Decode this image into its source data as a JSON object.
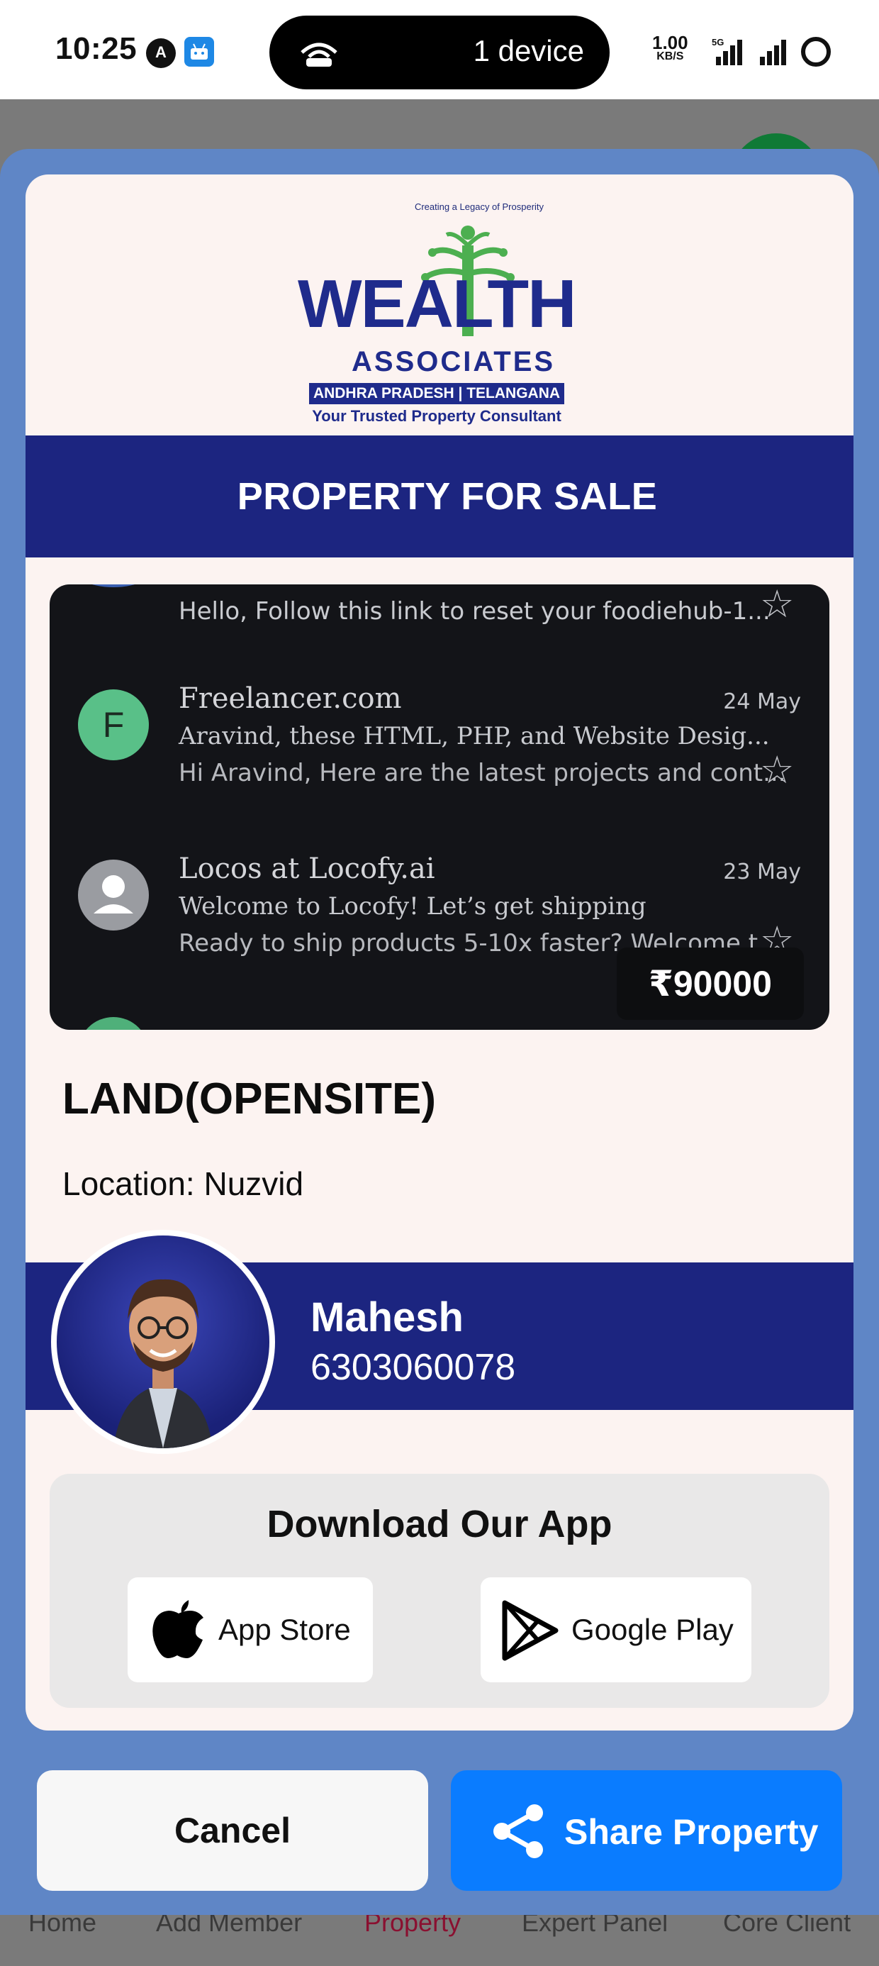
{
  "status_bar": {
    "time": "10:25",
    "hotspot_text": "1 device",
    "net_speed": "1.00",
    "net_unit": "KB/S",
    "icons": [
      "app-a-icon",
      "android-icon",
      "hotspot-icon",
      "5g-signal-icon",
      "signal-icon",
      "ring-icon"
    ]
  },
  "background_nav": {
    "items": [
      "Home",
      "Add Member",
      "Property",
      "Expert Panel",
      "Core Client"
    ],
    "active": "Property",
    "active_color": "#8a1030"
  },
  "logo": {
    "arc_text": "Creating a Legacy of Prosperity",
    "word": "WEALTH",
    "associates": "ASSOCIATES",
    "states": "ANDHRA PRADESH | TELANGANA",
    "tagline": "Your Trusted Property Consultant"
  },
  "banner": {
    "title": "PROPERTY FOR SALE"
  },
  "photo": {
    "top_preview": "Hello, Follow this link to reset your foodiehub-1...",
    "emails": [
      {
        "avatar_letter": "F",
        "sender": "Freelancer.com",
        "date": "24 May",
        "subject": "Aravind, these HTML, PHP, and Website Desig...",
        "preview": "Hi Aravind, Here are the latest projects and cont..."
      },
      {
        "avatar_letter": "",
        "sender": "Locos at Locofy.ai",
        "date": "23 May",
        "subject": "Welcome to Locofy! Let’s get shipping",
        "preview": "Ready to ship products 5-10x faster? Welcome t..."
      }
    ],
    "price": "₹90000"
  },
  "property": {
    "type": "LAND(OPENSITE)",
    "location": "Location: Nuzvid"
  },
  "agent": {
    "name": "Mahesh",
    "phone": "6303060078"
  },
  "download": {
    "title": "Download Our App",
    "app_store": "App Store",
    "google_play": "Google Play"
  },
  "actions": {
    "cancel": "Cancel",
    "share": "Share Property"
  },
  "colors": {
    "modal_bg": "#5f86c6",
    "card_bg": "#fcf3f1",
    "brand_navy": "#1c2580",
    "share_blue": "#0a7cff"
  }
}
